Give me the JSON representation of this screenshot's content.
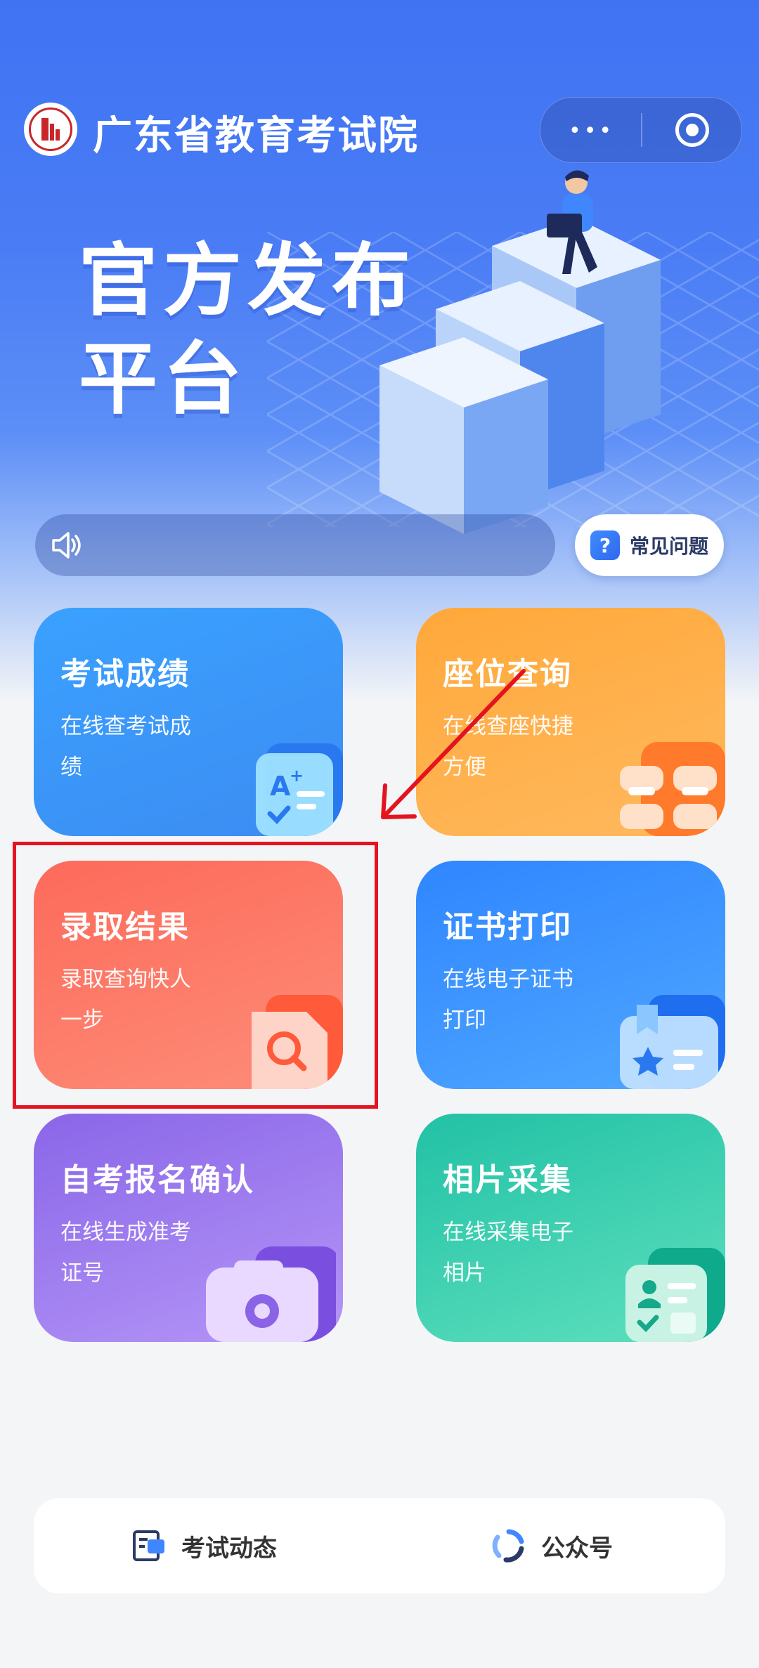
{
  "header": {
    "app_title": "广东省教育考试院",
    "slogan": "官方发布\n平台"
  },
  "notice": {
    "text": ""
  },
  "faq": {
    "label": "常见问题",
    "icon_char": "?"
  },
  "cards": [
    {
      "title": "考试成绩",
      "desc": "在线查考试成绩",
      "icon": "exam-score-icon"
    },
    {
      "title": "座位查询",
      "desc": "在线查座快捷方便",
      "icon": "seat-query-icon"
    },
    {
      "title": "录取结果",
      "desc": "录取查询快人一步",
      "icon": "admission-search-icon"
    },
    {
      "title": "证书打印",
      "desc": "在线电子证书打印",
      "icon": "certificate-icon"
    },
    {
      "title": "自考报名确认",
      "desc": "在线生成准考证号",
      "icon": "camera-icon"
    },
    {
      "title": "相片采集",
      "desc": "在线采集电子相片",
      "icon": "photo-collect-icon"
    }
  ],
  "bottom_nav": {
    "news_label": "考试动态",
    "official_label": "公众号"
  },
  "colors": {
    "highlight": "#e4141f",
    "brand_blue": "#3f73f2"
  }
}
